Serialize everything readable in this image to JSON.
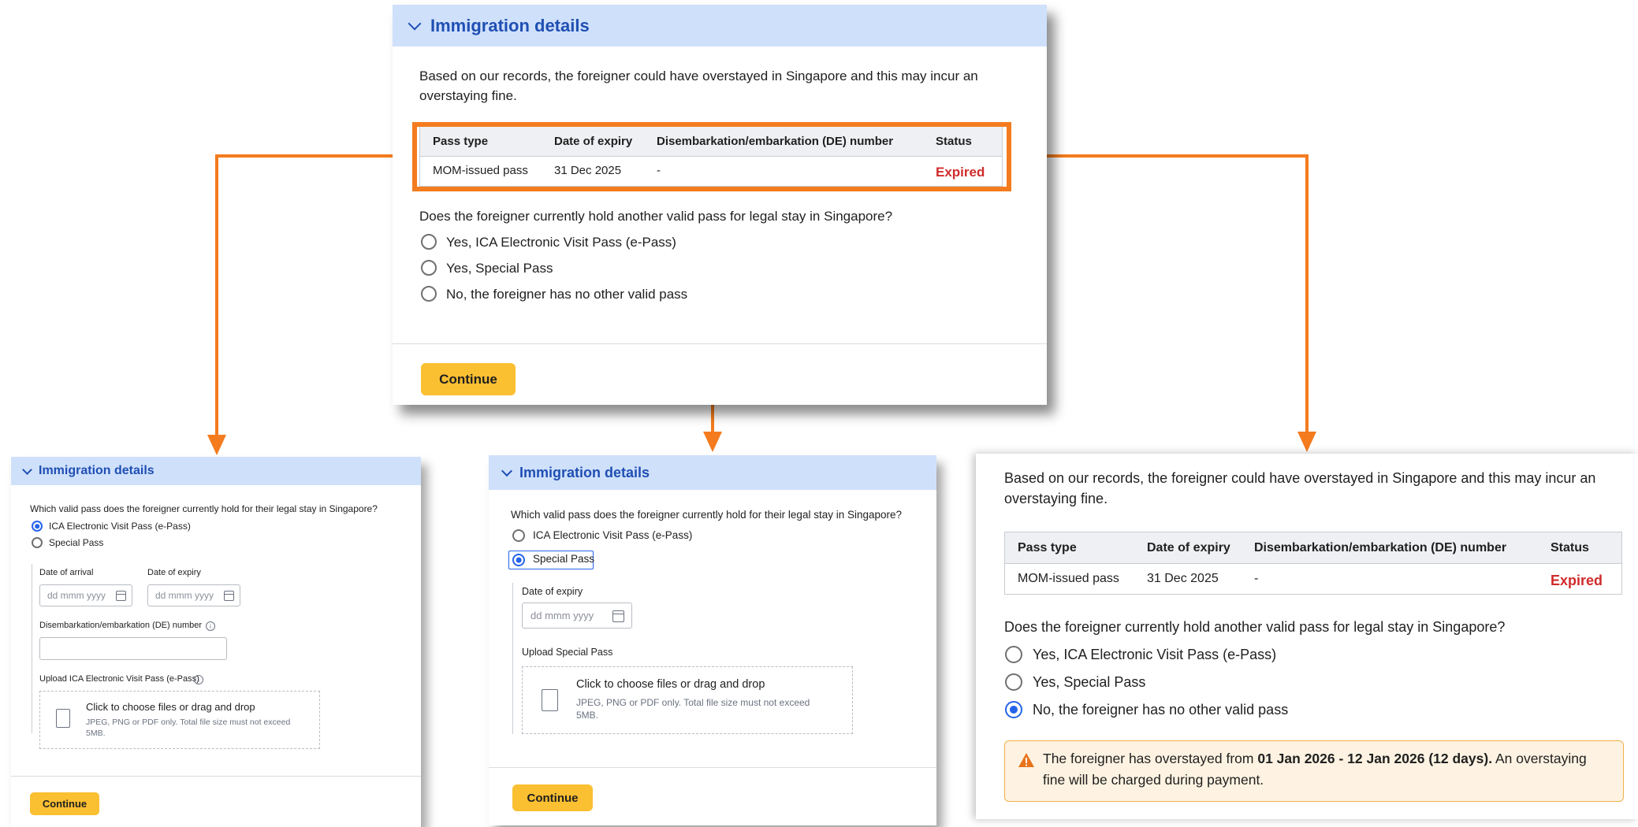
{
  "section": {
    "title": "Immigration details"
  },
  "record": {
    "notice": "Based on our records, the foreigner could have overstayed in Singapore and this may incur an",
    "notice_2": "overstaying fine.",
    "table": {
      "headers": [
        "Pass type",
        "Date of expiry",
        "Disembarkation/embarkation (DE) number",
        "Status"
      ],
      "row": [
        "MOM-issued pass",
        "31 Dec 2025",
        "-",
        "Expired"
      ]
    }
  },
  "question": {
    "label": "Does the foreigner currently hold another valid pass for legal stay in Singapore?",
    "options": [
      "Yes, ICA Electronic Visit Pass (e-Pass)",
      "Yes, Special Pass",
      "No, the foreigner has no other valid pass"
    ]
  },
  "continue_label": "Continue",
  "detail": {
    "question": "Which valid pass does the foreigner currently hold for their legal stay in Singapore?",
    "options": [
      "ICA Electronic Visit Pass (e-Pass)",
      "Special Pass"
    ],
    "date_of_arrival": "Date of arrival",
    "date_of_expiry": "Date of expiry",
    "date_placeholder": "dd mmm yyyy",
    "de_number": "Disembarkation/embarkation (DE) number",
    "upload_epass": "Upload ICA Electronic Visit Pass (e-Pass)",
    "upload_special": "Upload Special Pass",
    "drop_title": "Click to choose files or drag and drop",
    "drop_hint": "JPEG, PNG or PDF only. Total file size must not exceed",
    "drop_hint_2": "5MB."
  },
  "warning": {
    "prefix": "The foreigner has overstayed from ",
    "range": "01 Jan 2026 - 12 Jan 2026 (12 days).",
    "suffix": " An overstaying",
    "line2": "fine will be charged during payment."
  },
  "colors": {
    "accent": "#f47b1e",
    "header": "#cfe0fb",
    "primary": "#2563eb",
    "button": "#fbbf32",
    "expired": "#d02b2b"
  },
  "icons": [
    "chevron-down-icon",
    "calendar-icon",
    "upload-file-icon",
    "info-icon",
    "warning-icon"
  ]
}
